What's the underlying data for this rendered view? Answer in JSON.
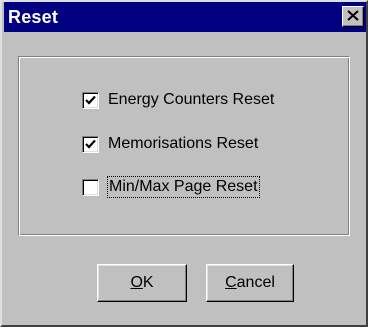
{
  "window": {
    "title": "Reset",
    "close_symbol": "×"
  },
  "options": [
    {
      "label": "Energy Counters Reset",
      "checked": true
    },
    {
      "label": "Memorisations Reset",
      "checked": true
    },
    {
      "label": "Min/Max Page Reset",
      "checked": false,
      "focused": true
    }
  ],
  "buttons": {
    "ok_label": "OK",
    "cancel_label": "Cancel"
  },
  "colors": {
    "titlebar": "#000080",
    "face": "#c0c0c0"
  },
  "icons": {
    "close": "close-icon",
    "check": "checkmark-icon"
  }
}
